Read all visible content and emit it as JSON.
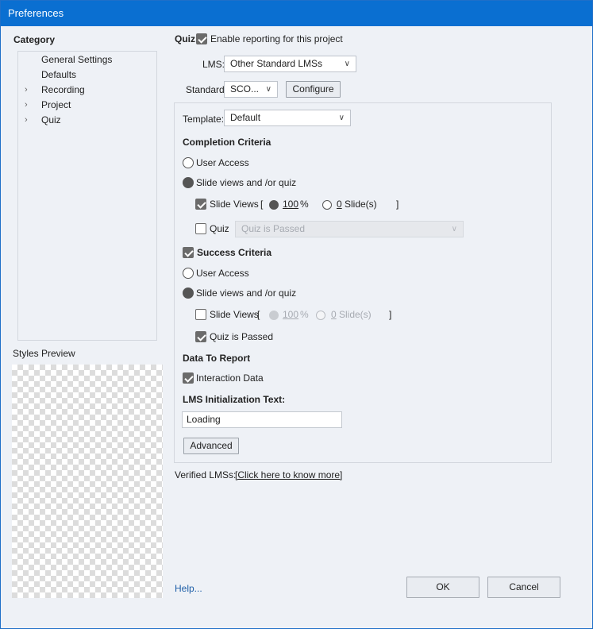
{
  "window": {
    "title": "Preferences"
  },
  "sidebar": {
    "category_label": "Category",
    "items": [
      {
        "label": "General Settings",
        "expandable": false
      },
      {
        "label": "Defaults",
        "expandable": false
      },
      {
        "label": "Recording",
        "expandable": true
      },
      {
        "label": "Project",
        "expandable": true
      },
      {
        "label": "Quiz",
        "expandable": true
      }
    ],
    "styles_preview_label": "Styles Preview"
  },
  "quiz": {
    "label": "Quiz:",
    "enable_reporting_label": "Enable reporting for this project",
    "enable_reporting_checked": true
  },
  "lms": {
    "label": "LMS:",
    "value": "Other Standard LMSs"
  },
  "standard": {
    "label": "Standard:",
    "value": "SCO...",
    "configure_label": "Configure"
  },
  "template": {
    "label": "Template:",
    "value": "Default"
  },
  "completion": {
    "heading": "Completion Criteria",
    "user_access_label": "User Access",
    "slide_views_quiz_label": "Slide views and /or quiz",
    "slide_views_label": "Slide Views",
    "open_bracket": "[",
    "close_bracket": "]",
    "percent_value": "100",
    "percent_sign": "%",
    "slides_value": "0",
    "slides_label": "Slide(s)",
    "quiz_label": "Quiz",
    "quiz_dropdown_value": "Quiz is Passed"
  },
  "success": {
    "heading": "Success Criteria",
    "user_access_label": "User Access",
    "slide_views_quiz_label": "Slide views and /or quiz",
    "slide_views_label": "Slide Views",
    "open_bracket": "[",
    "close_bracket": "]",
    "percent_value": "100",
    "percent_sign": "%",
    "slides_value": "0",
    "slides_label": "Slide(s)",
    "quiz_passed_label": "Quiz is Passed"
  },
  "report": {
    "heading": "Data To Report",
    "interaction_data_label": "Interaction Data",
    "lms_init_label": "LMS Initialization Text:",
    "lms_init_value": "Loading",
    "advanced_label": "Advanced"
  },
  "verified": {
    "label": "Verified LMSs:",
    "link": "[Click here to know more]"
  },
  "footer": {
    "help": "Help...",
    "ok": "OK",
    "cancel": "Cancel"
  }
}
